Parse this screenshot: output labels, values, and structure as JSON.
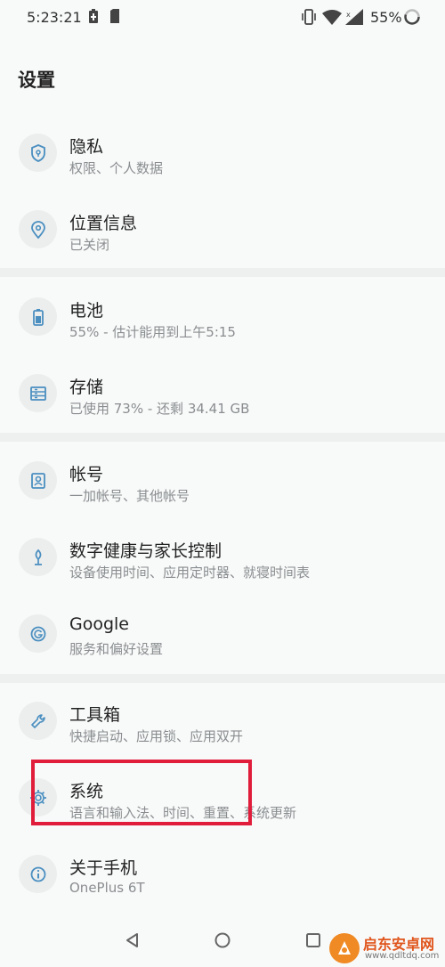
{
  "status_bar": {
    "time": "5:23:21",
    "battery_percent": "55%"
  },
  "page": {
    "title": "设置"
  },
  "items": [
    {
      "title": "隐私",
      "subtitle": "权限、个人数据",
      "icon": "shield-icon"
    },
    {
      "title": "位置信息",
      "subtitle": "已关闭",
      "icon": "location-pin-icon"
    },
    {
      "title": "电池",
      "subtitle": "55% - 估计能用到上午5:15",
      "icon": "battery-icon"
    },
    {
      "title": "存储",
      "subtitle": "已使用 73% - 还剩 34.41 GB",
      "icon": "storage-icon"
    },
    {
      "title": "帐号",
      "subtitle": "一加帐号、其他帐号",
      "icon": "account-icon"
    },
    {
      "title": "数字健康与家长控制",
      "subtitle": "设备使用时间、应用定时器、就寝时间表",
      "icon": "digital-wellbeing-icon"
    },
    {
      "title": "Google",
      "subtitle": "服务和偏好设置",
      "icon": "google-icon"
    },
    {
      "title": "工具箱",
      "subtitle": "快捷启动、应用锁、应用双开",
      "icon": "toolbox-icon"
    },
    {
      "title": "系统",
      "subtitle": "语言和输入法、时间、重置、系统更新",
      "icon": "gear-icon"
    },
    {
      "title": "关于手机",
      "subtitle": "OnePlus 6T",
      "icon": "info-icon"
    }
  ],
  "watermark": {
    "title": "启东安卓网",
    "url": "www.qdltdq.com"
  },
  "colors": {
    "accent": "#4b8fc0",
    "highlight": "#e11d3c",
    "background": "#f8f9f9"
  }
}
